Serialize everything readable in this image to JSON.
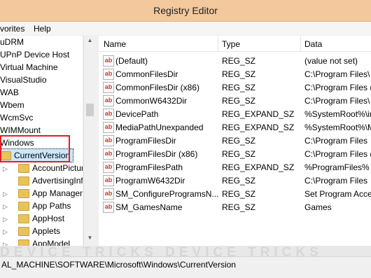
{
  "window": {
    "title": "Registry Editor"
  },
  "menu": [
    "vorites",
    "Help"
  ],
  "tree": {
    "items": [
      "uDRM",
      "UPnP Device Host",
      "Virtual Machine",
      "VisualStudio",
      "WAB",
      "Wbem",
      "WcmSvc",
      "WIMMount",
      "Windows"
    ],
    "selected": "CurrentVersion",
    "children": [
      "AccountPicture",
      "AdvertisingInfo",
      "App Manageme",
      "App Paths",
      "AppHost",
      "Applets",
      "AppModel"
    ]
  },
  "columns": {
    "name": "Name",
    "type": "Type",
    "data": "Data"
  },
  "values": [
    {
      "name": "(Default)",
      "type": "REG_SZ",
      "data": "(value not set)"
    },
    {
      "name": "CommonFilesDir",
      "type": "REG_SZ",
      "data": "C:\\Program Files\\"
    },
    {
      "name": "CommonFilesDir (x86)",
      "type": "REG_SZ",
      "data": "C:\\Program Files ("
    },
    {
      "name": "CommonW6432Dir",
      "type": "REG_SZ",
      "data": "C:\\Program Files\\"
    },
    {
      "name": "DevicePath",
      "type": "REG_EXPAND_SZ",
      "data": "%SystemRoot%\\ir"
    },
    {
      "name": "MediaPathUnexpanded",
      "type": "REG_EXPAND_SZ",
      "data": "%SystemRoot%\\M"
    },
    {
      "name": "ProgramFilesDir",
      "type": "REG_SZ",
      "data": "C:\\Program Files"
    },
    {
      "name": "ProgramFilesDir (x86)",
      "type": "REG_SZ",
      "data": "C:\\Program Files ("
    },
    {
      "name": "ProgramFilesPath",
      "type": "REG_EXPAND_SZ",
      "data": "%ProgramFiles%"
    },
    {
      "name": "ProgramW6432Dir",
      "type": "REG_SZ",
      "data": "C:\\Program Files"
    },
    {
      "name": "SM_ConfigureProgramsN...",
      "type": "REG_SZ",
      "data": "Set Program Acce"
    },
    {
      "name": "SM_GamesName",
      "type": "REG_SZ",
      "data": "Games"
    }
  ],
  "status": {
    "path": "AL_MACHINE\\SOFTWARE\\Microsoft\\Windows\\CurrentVersion"
  },
  "watermark": "DEVICE TRICKS  DEVICE TRICKS"
}
